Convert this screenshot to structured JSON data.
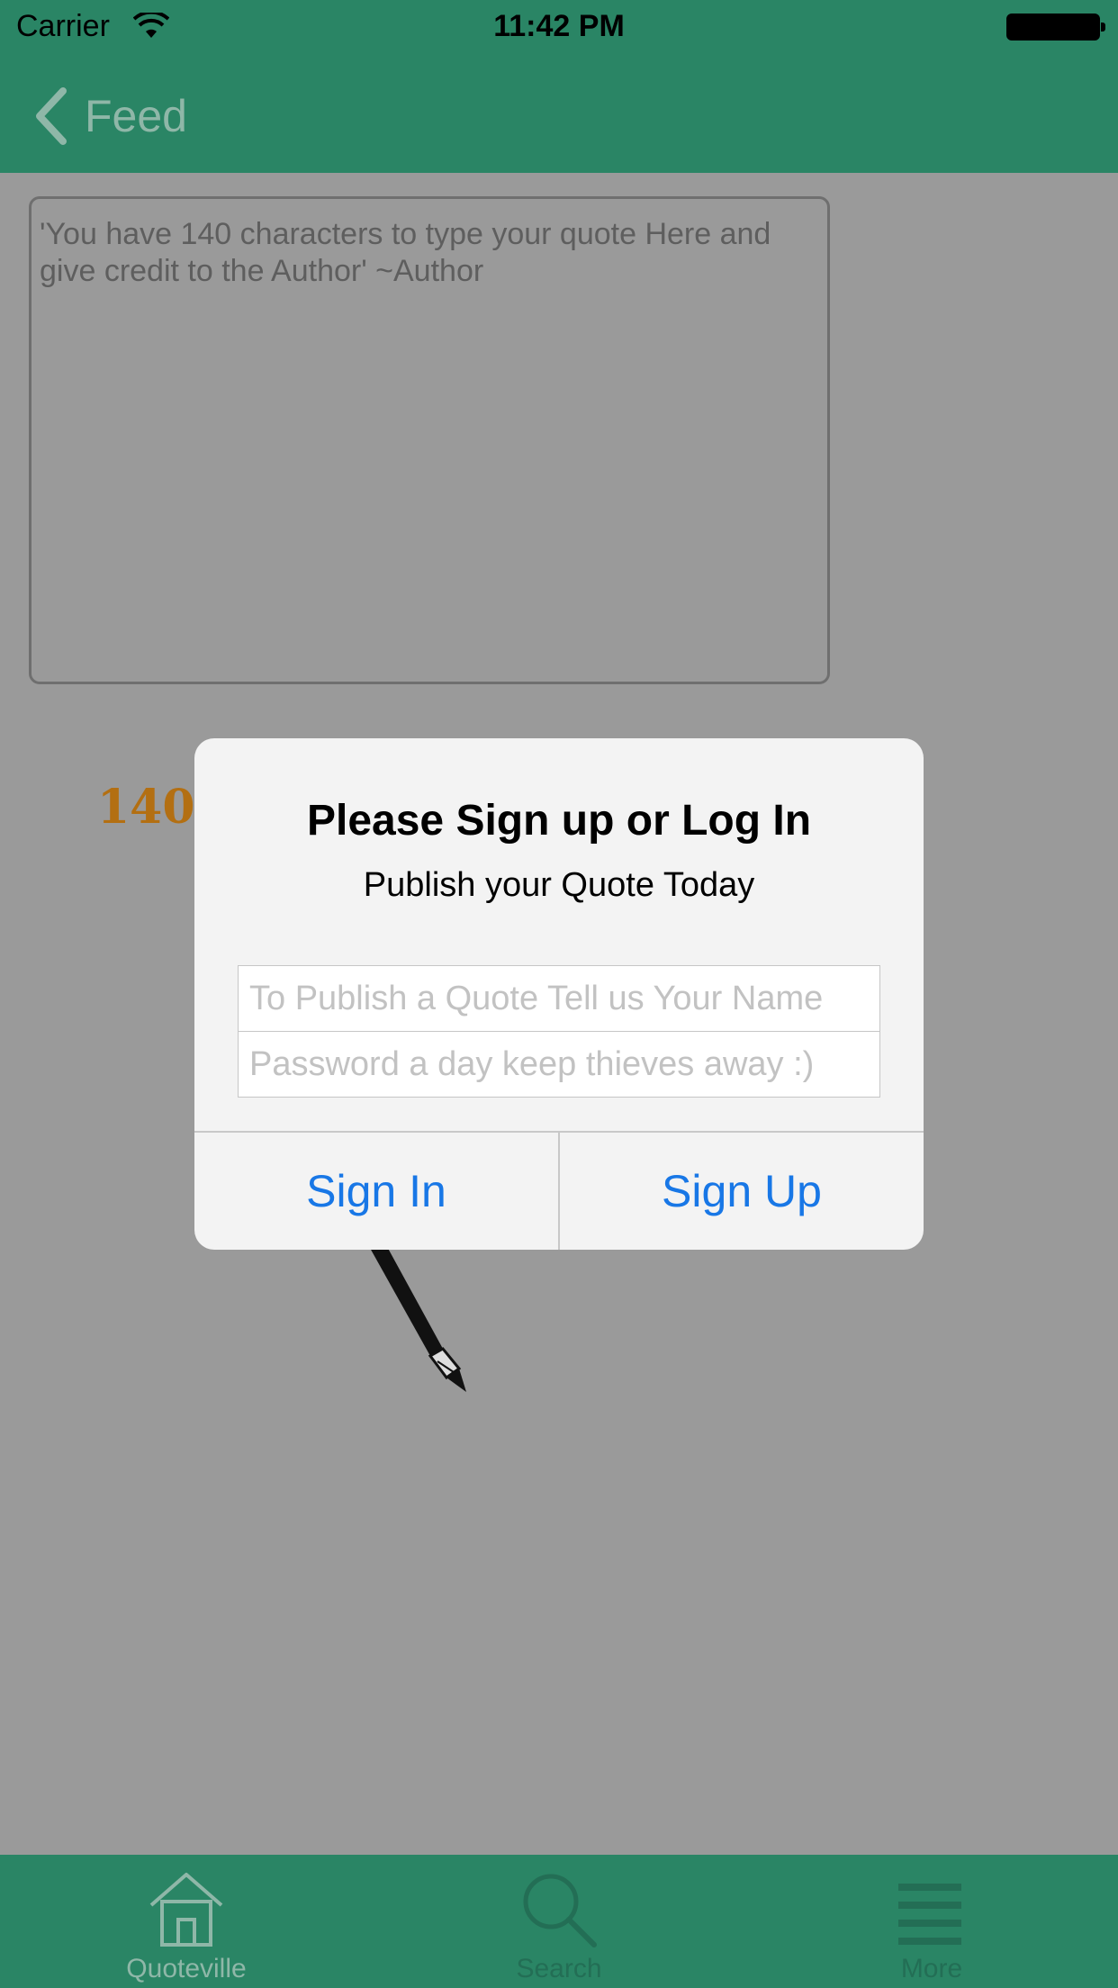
{
  "status_bar": {
    "carrier": "Carrier",
    "time": "11:42 PM",
    "icons": [
      "wifi-icon",
      "battery-icon"
    ]
  },
  "nav": {
    "back_label": "Feed",
    "back_icon": "chevron-left-icon"
  },
  "composer": {
    "placeholder": "'You have 140 characters to type your quote Here and give credit to the Author'  ~Author",
    "char_count_visible": "140"
  },
  "alert": {
    "title": "Please Sign up or Log In",
    "message": "Publish your Quote Today",
    "name_placeholder": "To Publish a Quote Tell us Your Name",
    "password_placeholder": "Password a day keep thieves away :)",
    "sign_in_label": "Sign In",
    "sign_up_label": "Sign Up"
  },
  "tab_bar": {
    "items": [
      {
        "label": "Quoteville",
        "icon": "home-icon"
      },
      {
        "label": "Search",
        "icon": "search-icon"
      },
      {
        "label": "More",
        "icon": "menu-icon"
      }
    ]
  },
  "colors": {
    "brand_green": "#2a8565",
    "dim_overlay": "#9a9a9a",
    "alert_button_blue": "#1877e6",
    "counter_orange": "#b36f12"
  }
}
